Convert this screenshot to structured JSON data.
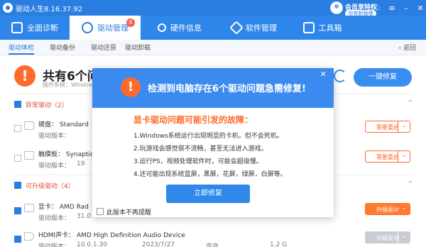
{
  "app": {
    "title": "驱动人生8.16.37.92",
    "vip_label": "会员享特权",
    "new_version_label": "你有新版哦"
  },
  "nav": {
    "tabs": [
      {
        "label": "全面诊断"
      },
      {
        "label": "驱动管理",
        "badge": "6"
      },
      {
        "label": "硬件信息"
      },
      {
        "label": "软件管理"
      },
      {
        "label": "工具箱"
      }
    ]
  },
  "subtabs": {
    "items": [
      "驱动体检",
      "驱动备份",
      "驱动还原",
      "驱动卸载"
    ],
    "back": "返回"
  },
  "summary": {
    "title": "共有6个问题",
    "sub": "操作系统：Windows",
    "onekey": "一键修复"
  },
  "sections": [
    {
      "label": "异常驱动（2）"
    },
    {
      "label": "可升级驱动（4）"
    }
  ],
  "rows": [
    {
      "name": "键盘：  Standard",
      "ver_label": "驱动版本：",
      "ver": "",
      "action": "需要重启"
    },
    {
      "name": "触摸板：  Synaptic",
      "ver_label": "驱动版本：",
      "ver": "19",
      "action": "需要重启"
    },
    {
      "name": "显卡：  AMD Rad",
      "ver_label": "驱动版本：",
      "ver": "31.0",
      "action": "升级驱动"
    },
    {
      "name": "HDMI声卡：  AMD High Definition Audio Device",
      "ver_label": "驱动版本：",
      "ver": "10.0.1.30",
      "date": "2023/7/27",
      "extra1": "声音",
      "size": "1.2 G",
      "action": "升级驱动"
    }
  ],
  "dialog": {
    "title": "检测到电脑存在6个驱动问题急需修复!",
    "subtitle": "显卡驱动问题可能引发的故障：",
    "items": [
      "1.Windows系统运行出现明显的卡机，但不会死机。",
      "2.玩游戏会感觉很不流畅，甚至无法进入游戏。",
      "3.运行PS，视频处理软件时，可能会超级慢。",
      "4.还可能出现系统蓝屏，黑屏，花屏，绿屏，白屏等。"
    ],
    "button": "立即修复",
    "no_remind": "此版本不再提醒"
  }
}
